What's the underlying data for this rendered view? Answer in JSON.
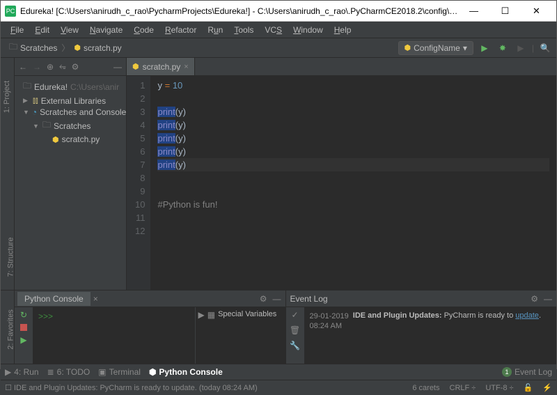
{
  "title": "Edureka! [C:\\Users\\anirudh_c_rao\\PycharmProjects\\Edureka!] - C:\\Users\\anirudh_c_rao\\.PyCharmCE2018.2\\config\\scratches\\s...",
  "menu": [
    "File",
    "Edit",
    "View",
    "Navigate",
    "Code",
    "Refactor",
    "Run",
    "Tools",
    "VCS",
    "Window",
    "Help"
  ],
  "breadcrumb": {
    "root": "Scratches",
    "file": "scratch.py"
  },
  "config": {
    "label": "ConfigName"
  },
  "sidestrips": {
    "project": "1: Project",
    "structure": "7: Structure",
    "favorites": "2: Favorites"
  },
  "tree": {
    "root": "Edureka!",
    "rootPath": "C:\\Users\\anir",
    "ext": "External Libraries",
    "scr": "Scratches and Consoles",
    "scratches": "Scratches",
    "file": "scratch.py"
  },
  "editor": {
    "tab": "scratch.py",
    "lines": [
      "1",
      "2",
      "3",
      "4",
      "5",
      "6",
      "7",
      "8",
      "9",
      "10",
      "11",
      "12"
    ],
    "code": {
      "l1a": "y ",
      "l1b": "= ",
      "l1c": "10",
      "print": "print",
      "arg": "y",
      "comment": "#Python is fun!"
    }
  },
  "console": {
    "title": "Python Console",
    "vars": "Special Variables",
    "prompt": ">>>"
  },
  "eventlog": {
    "title": "Event Log",
    "date": "29-01-2019",
    "time": "08:24 AM",
    "bold": "IDE and Plugin Updates:",
    "msg": " PyCharm is ready to ",
    "link": "update"
  },
  "toolwin": {
    "run": "4: Run",
    "todo": "6: TODO",
    "term": "Terminal",
    "pyc": "Python Console",
    "ev": "Event Log",
    "evn": "1"
  },
  "status": {
    "msg": "IDE and Plugin Updates: PyCharm is ready to update. (today 08:24 AM)",
    "carets": "6 carets",
    "crlf": "CRLF",
    "enc": "UTF-8"
  }
}
